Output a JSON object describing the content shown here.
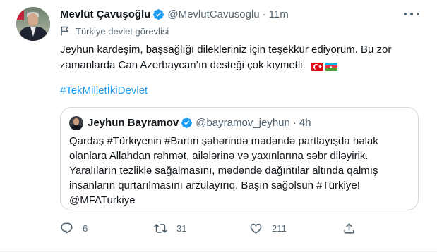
{
  "tweet": {
    "author_name": "Mevlüt Çavuşoğlu",
    "handle": "@MevlutCavusoglu",
    "separator": "·",
    "time": "11m",
    "label": "Türkiye devlet görevlisi",
    "text_line1": "Jeyhun kardeşim, başsağlığı dilekleriniz için teşekkür ediyorum. Bu zor",
    "text_line2": "zamanlarda Can Azerbaycan’ın desteği çok kıymetli.",
    "flags": [
      "turkey-flag",
      "azerbaijan-flag"
    ],
    "hashtag": "#TekMilletİkiDevlet"
  },
  "quote": {
    "author_name": "Jeyhun Bayramov",
    "handle": "@bayramov_jeyhun",
    "separator": "·",
    "time": "4h",
    "lines": [
      "Qardaş #Türkiyenin #Bartın şəhərində mədəndə partlayışda həlak",
      "olanlara Allahdan rəhmət, ailələrinə və yaxınlarına səbr diləyirik.",
      "Yaralıların tezliklə sağalmasını, mədəndə dağıntılar altında qalmış",
      "insanların qurtarılmasını arzulayırıq. Başın sağolsun #Türkiye!",
      "@MFATurkiye"
    ]
  },
  "actions": {
    "reply": {
      "icon": "reply-icon",
      "count": "6"
    },
    "retweet": {
      "icon": "retweet-icon",
      "count": "31"
    },
    "like": {
      "icon": "heart-icon",
      "count": "211"
    },
    "share": {
      "icon": "share-icon"
    }
  },
  "colors": {
    "accent": "#1d9bf0",
    "secondary_text": "#536471",
    "primary_text": "#0f1419",
    "border": "#cfd9de"
  }
}
